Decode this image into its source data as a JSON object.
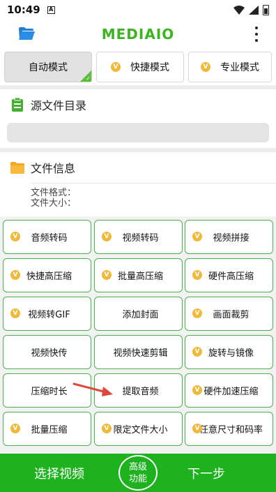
{
  "statusbar": {
    "time": "10:49",
    "sim": "A"
  },
  "app": {
    "title": "MEDIAIO"
  },
  "modes": [
    {
      "label": "自动模式",
      "active": true
    },
    {
      "label": "快捷模式",
      "badge": "V"
    },
    {
      "label": "专业模式",
      "badge": "V"
    }
  ],
  "source": {
    "title": "源文件目录",
    "path_value": ""
  },
  "fileinfo": {
    "title": "文件信息",
    "format_label": "文件格式：",
    "size_label": "文件大小："
  },
  "functions": [
    {
      "label": "音频转码",
      "badge": "V"
    },
    {
      "label": "视频转码",
      "badge": "V"
    },
    {
      "label": "视频拼接",
      "badge": "V"
    },
    {
      "label": "快捷高压缩",
      "badge": "V"
    },
    {
      "label": "批量高压缩",
      "badge": "V"
    },
    {
      "label": "硬件高压缩",
      "badge": "V"
    },
    {
      "label": "视频转GIF",
      "badge": "V"
    },
    {
      "label": "添加封面"
    },
    {
      "label": "画面裁剪",
      "badge": "V"
    },
    {
      "label": "视频快传"
    },
    {
      "label": "视频快速剪辑"
    },
    {
      "label": "旋转与镜像",
      "badge": "V"
    },
    {
      "label": "压缩时长"
    },
    {
      "label": "提取音频"
    },
    {
      "label": "硬件加速压缩",
      "badge": "V"
    },
    {
      "label": "批量压缩",
      "badge": "V"
    },
    {
      "label": "限定文件大小",
      "badge": "V"
    },
    {
      "label": "任意尺寸和码率",
      "badge": "V"
    }
  ],
  "bottom": {
    "select_label": "选择视频",
    "advanced_line1": "高级",
    "advanced_line2": "功能",
    "next_label": "下一步"
  },
  "colors": {
    "brand_green": "#3cb521",
    "button_border": "#47b34a",
    "bottom_bar": "#1eb31e",
    "badge": "#f0b93a",
    "arrow": "#e0463a"
  }
}
